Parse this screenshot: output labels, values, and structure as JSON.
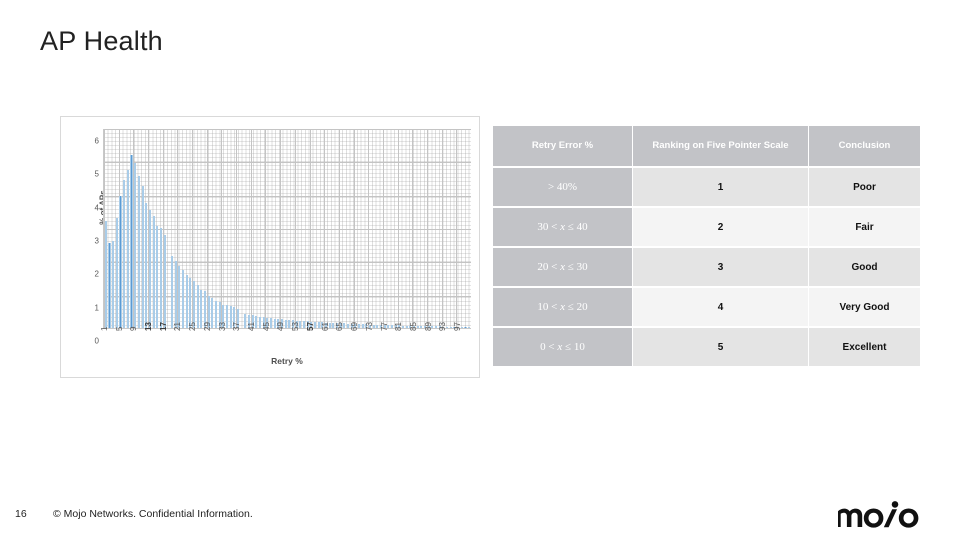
{
  "slide": {
    "title": "AP Health",
    "number": "16",
    "footer_note": "© Mojo Networks. Confidential Information.",
    "logo_text": "mojo",
    "background": "#ffffff"
  },
  "table": {
    "headers": [
      "Retry Error %",
      "Ranking on Five Pointer Scale",
      "Conclusion"
    ],
    "header_bg": "#c2c3c7",
    "header_color": "#ffffff",
    "range_col_bg": "#c2c3c7",
    "row_bg_odd": "#e4e4e4",
    "row_bg_even": "#f4f4f4",
    "rows": [
      {
        "range": "> 40%",
        "rank": "1",
        "conclusion": "Poor"
      },
      {
        "range": "30 < x ≤ 40",
        "rank": "2",
        "conclusion": "Fair"
      },
      {
        "range": "20 < x ≤ 30",
        "rank": "3",
        "conclusion": "Good"
      },
      {
        "range": "10 < x ≤ 20",
        "rank": "4",
        "conclusion": "Very Good"
      },
      {
        "range": "0 < x ≤ 10",
        "rank": "5",
        "conclusion": "Excellent"
      }
    ]
  },
  "chart_data": {
    "type": "bar",
    "title": "",
    "xlabel": "Retry %",
    "ylabel": "% of APs",
    "ylim": [
      0,
      6
    ],
    "yticks": [
      0,
      1,
      2,
      3,
      4,
      5,
      6
    ],
    "xtick_labels": [
      "1",
      "5",
      "9",
      "13",
      "17",
      "21",
      "25",
      "29",
      "33",
      "37",
      "41",
      "45",
      "49",
      "53",
      "57",
      "61",
      "65",
      "69",
      "73",
      "77",
      "81",
      "85",
      "89",
      "93",
      "97"
    ],
    "xtick_bold": [
      "13",
      "17",
      "57"
    ],
    "grid": true,
    "legend": "none",
    "bar_color": "#5b9bd5",
    "bar_edge_color": "#a9cce8",
    "x": [
      1,
      2,
      3,
      4,
      5,
      6,
      7,
      8,
      9,
      10,
      11,
      12,
      13,
      14,
      15,
      16,
      17,
      18,
      19,
      20,
      21,
      22,
      23,
      24,
      25,
      26,
      27,
      28,
      29,
      30,
      31,
      32,
      33,
      34,
      35,
      36,
      37,
      38,
      39,
      40,
      41,
      42,
      43,
      44,
      45,
      46,
      47,
      48,
      49,
      50,
      51,
      52,
      53,
      54,
      55,
      56,
      57,
      58,
      59,
      60,
      61,
      62,
      63,
      64,
      65,
      66,
      67,
      68,
      69,
      70,
      71,
      72,
      73,
      74,
      75,
      76,
      77,
      78,
      79,
      80,
      81,
      82,
      83,
      84,
      85,
      86,
      87,
      88,
      89,
      90,
      91,
      92,
      93,
      94,
      95,
      96,
      97,
      98,
      99,
      100
    ],
    "values": [
      3.2,
      2.55,
      2.6,
      3.3,
      3.95,
      4.45,
      4.75,
      5.2,
      4.95,
      4.55,
      4.25,
      3.75,
      3.55,
      3.35,
      3.05,
      3.0,
      2.8,
      0.0,
      2.15,
      2.0,
      1.85,
      1.75,
      1.6,
      1.5,
      1.4,
      1.3,
      1.15,
      1.1,
      0.95,
      0.9,
      0.8,
      0.78,
      0.7,
      0.68,
      0.65,
      0.62,
      0.58,
      0.0,
      0.42,
      0.4,
      0.38,
      0.36,
      0.34,
      0.33,
      0.31,
      0.3,
      0.28,
      0.27,
      0.26,
      0.25,
      0.24,
      0.23,
      0.22,
      0.21,
      0.2,
      0.2,
      0.19,
      0.18,
      0.18,
      0.17,
      0.16,
      0.16,
      0.15,
      0.15,
      0.14,
      0.14,
      0.13,
      0.13,
      0.12,
      0.12,
      0.11,
      0.11,
      0.1,
      0.1,
      0.1,
      0.09,
      0.09,
      0.09,
      0.08,
      0.08,
      0.08,
      0.07,
      0.07,
      0.07,
      0.06,
      0.06,
      0.06,
      0.06,
      0.05,
      0.05,
      0.05,
      0.05,
      0.04,
      0.04,
      0.04,
      0.04,
      0.03,
      0.03,
      0.03,
      0.03
    ]
  }
}
